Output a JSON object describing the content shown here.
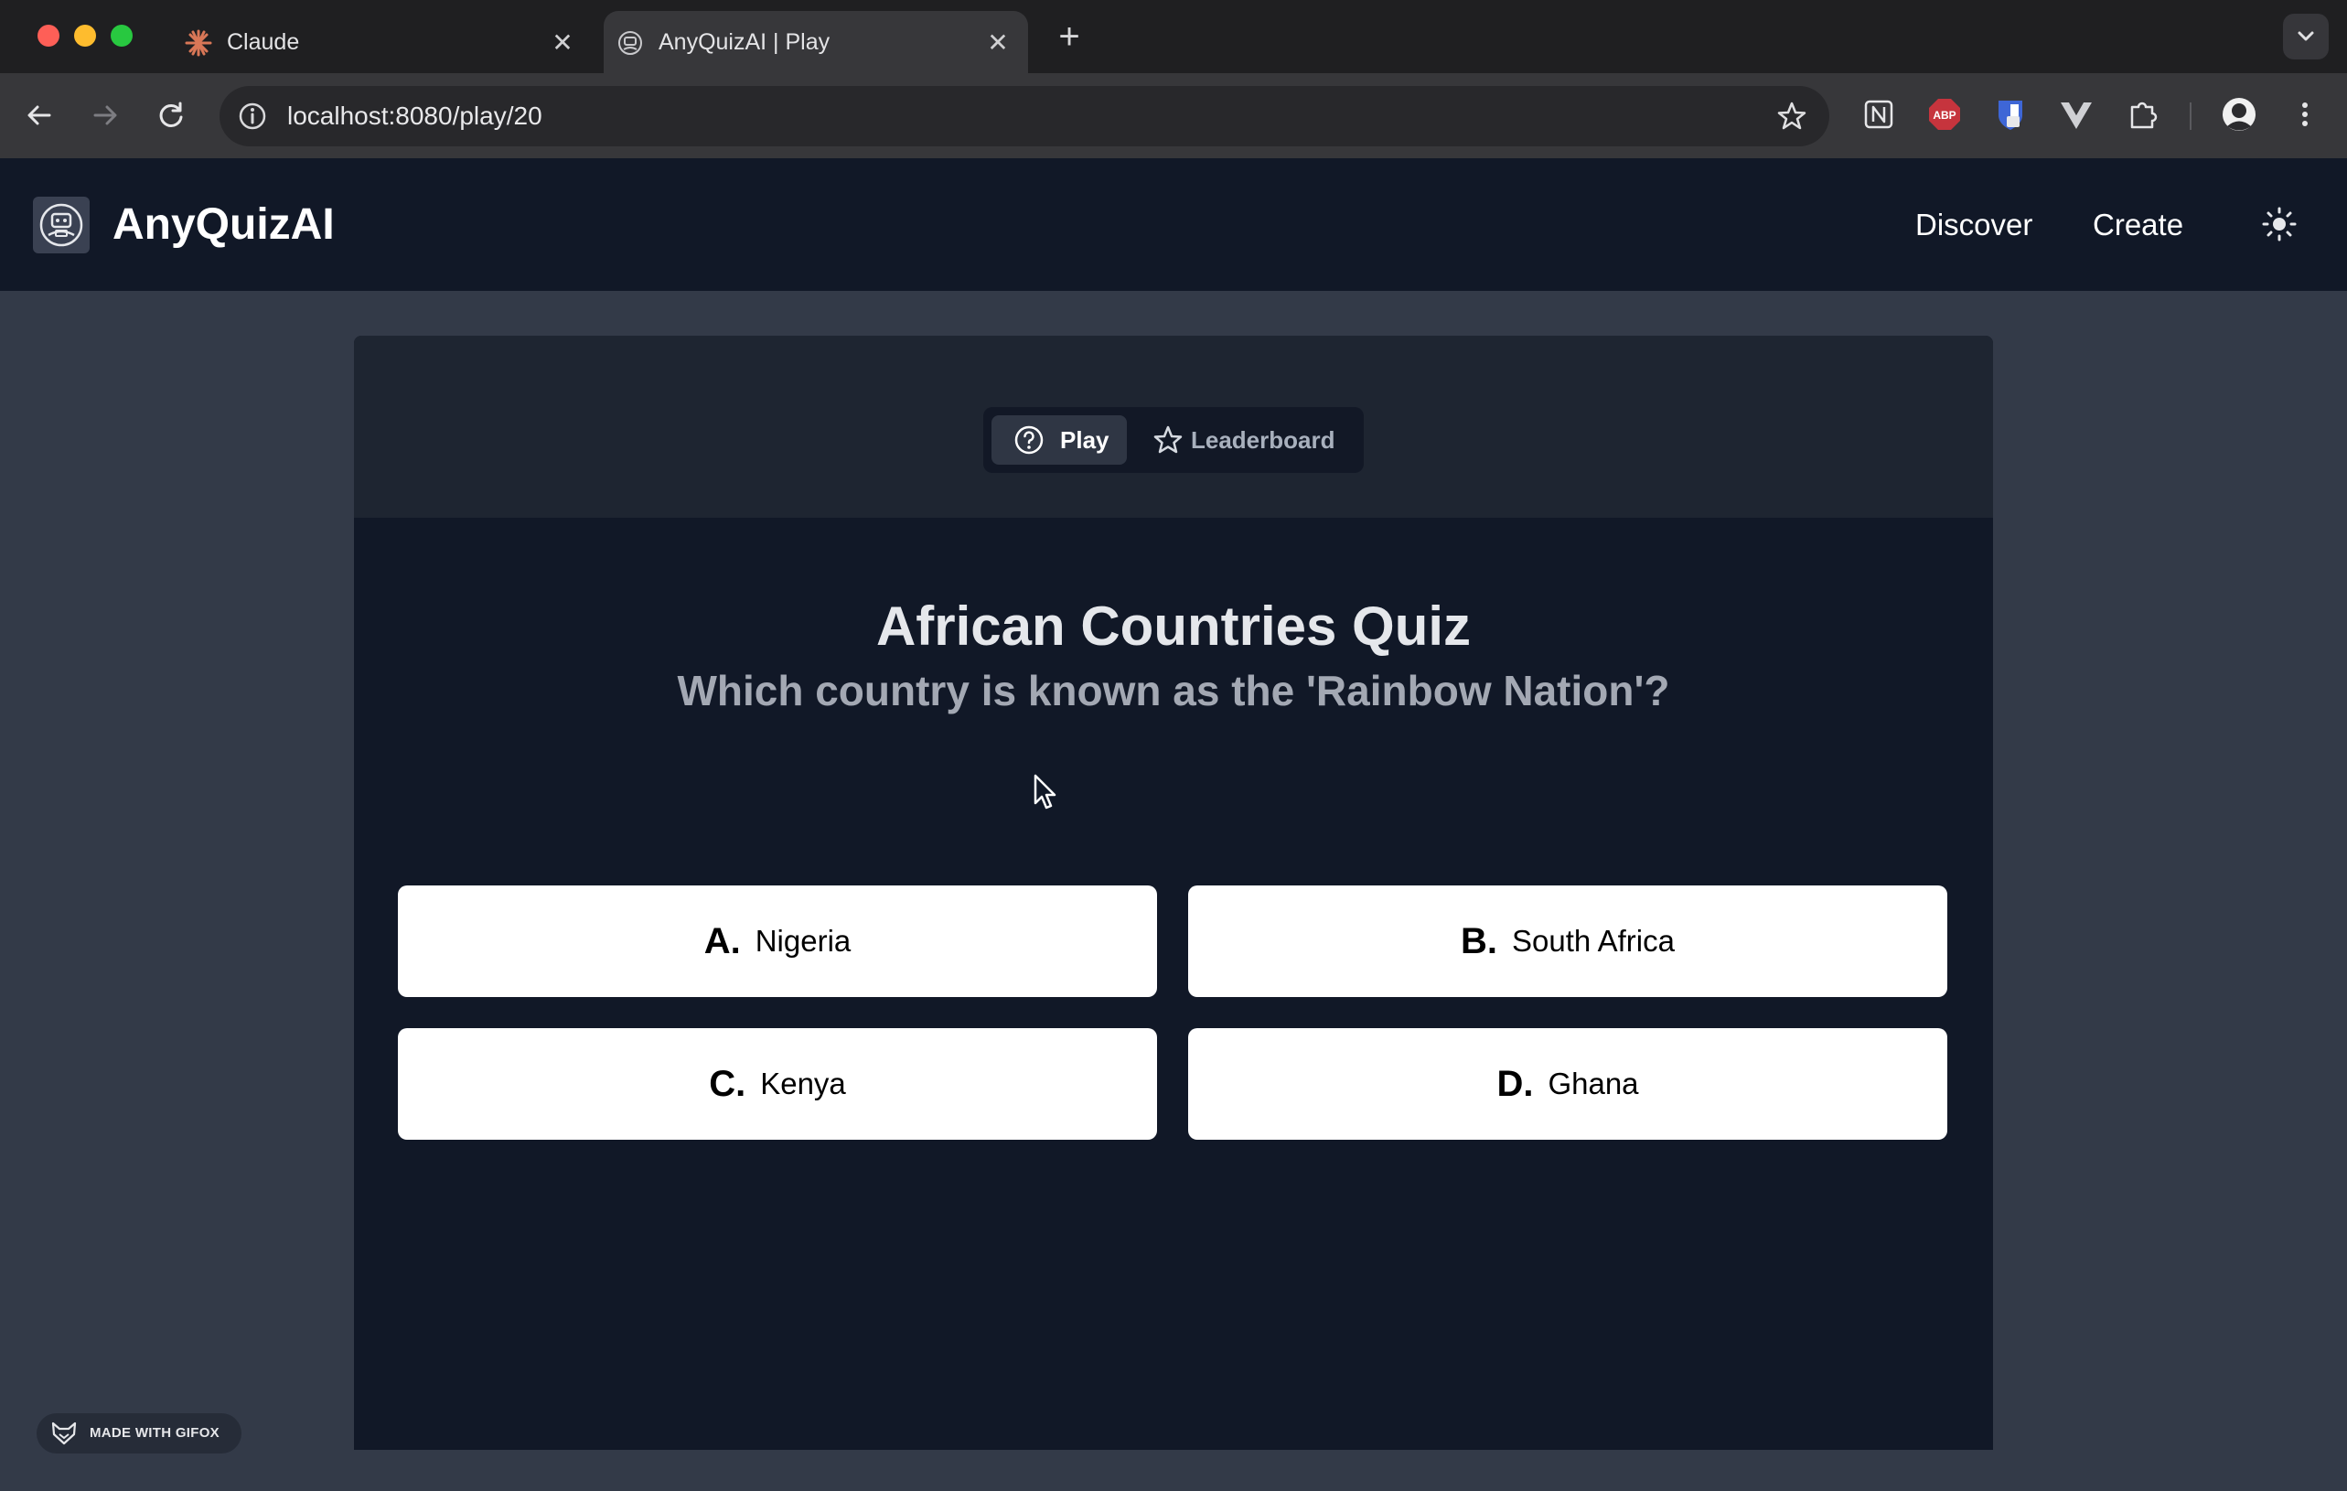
{
  "browser": {
    "tabs": [
      {
        "title": "Claude",
        "favicon": "claude-icon"
      },
      {
        "title": "AnyQuizAI | Play",
        "favicon": "anyquiz-icon",
        "active": true
      }
    ],
    "new_tab": "+",
    "close_glyph": "✕",
    "address": "localhost:8080/play/20",
    "extensions": [
      "notion-icon",
      "adblock-plus-icon",
      "bitwarden-icon",
      "vue-devtools-icon",
      "puzzle-icon",
      "profile-avatar"
    ],
    "adblock_label": "ABP"
  },
  "header": {
    "brand": "AnyQuizAI",
    "nav": {
      "discover": "Discover",
      "create": "Create"
    }
  },
  "modes": {
    "play": "Play",
    "leaderboard": "Leaderboard"
  },
  "quiz": {
    "title": "African Countries Quiz",
    "question": "Which country is known as the 'Rainbow Nation'?",
    "answers": [
      {
        "letter": "A.",
        "text": "Nigeria"
      },
      {
        "letter": "B.",
        "text": "South Africa"
      },
      {
        "letter": "C.",
        "text": "Kenya"
      },
      {
        "letter": "D.",
        "text": "Ghana"
      }
    ]
  },
  "watermark": "MADE WITH GIFOX",
  "colors": {
    "page_bg": "#333a48",
    "header_bg": "#111827",
    "card_bg": "#111827",
    "card_top_bg": "#1e2531",
    "answer_bg": "#ffffff"
  }
}
